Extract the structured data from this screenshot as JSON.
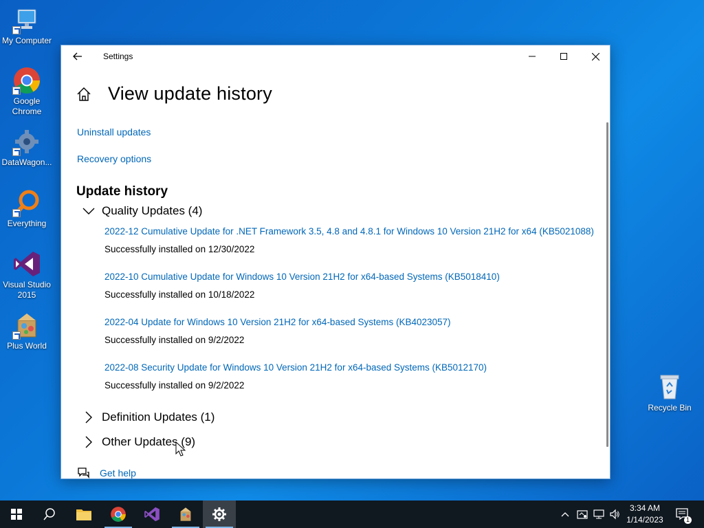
{
  "desktop": {
    "icons": [
      {
        "label": "My Computer"
      },
      {
        "label": "Google Chrome"
      },
      {
        "label": "DataWagon..."
      },
      {
        "label": "Everything"
      },
      {
        "label": "Visual Studio 2015"
      },
      {
        "label": "Plus World"
      },
      {
        "label": "Recycle Bin"
      }
    ]
  },
  "window": {
    "app_title": "Settings",
    "page_title": "View update history",
    "links": {
      "uninstall": "Uninstall updates",
      "recovery": "Recovery options"
    },
    "section_title": "Update history",
    "quality_group": "Quality Updates (4)",
    "updates": [
      {
        "title": "2022-12 Cumulative Update for .NET Framework 3.5, 4.8 and 4.8.1 for Windows 10 Version 21H2 for x64 (KB5021088)",
        "status": "Successfully installed on 12/30/2022"
      },
      {
        "title": "2022-10 Cumulative Update for Windows 10 Version 21H2 for x64-based Systems (KB5018410)",
        "status": "Successfully installed on 10/18/2022"
      },
      {
        "title": "2022-04 Update for Windows 10 Version 21H2 for x64-based Systems (KB4023057)",
        "status": "Successfully installed on 9/2/2022"
      },
      {
        "title": "2022-08 Security Update for Windows 10 Version 21H2 for x64-based Systems (KB5012170)",
        "status": "Successfully installed on 9/2/2022"
      }
    ],
    "definition_group": "Definition Updates (1)",
    "other_group": "Other Updates (9)",
    "help": "Get help"
  },
  "taskbar": {
    "time": "3:34 AM",
    "date": "1/14/2023",
    "notification_count": "1"
  },
  "colors": {
    "link": "#0067b8",
    "desktop": "#0b78d8",
    "taskbar": "#101820"
  }
}
